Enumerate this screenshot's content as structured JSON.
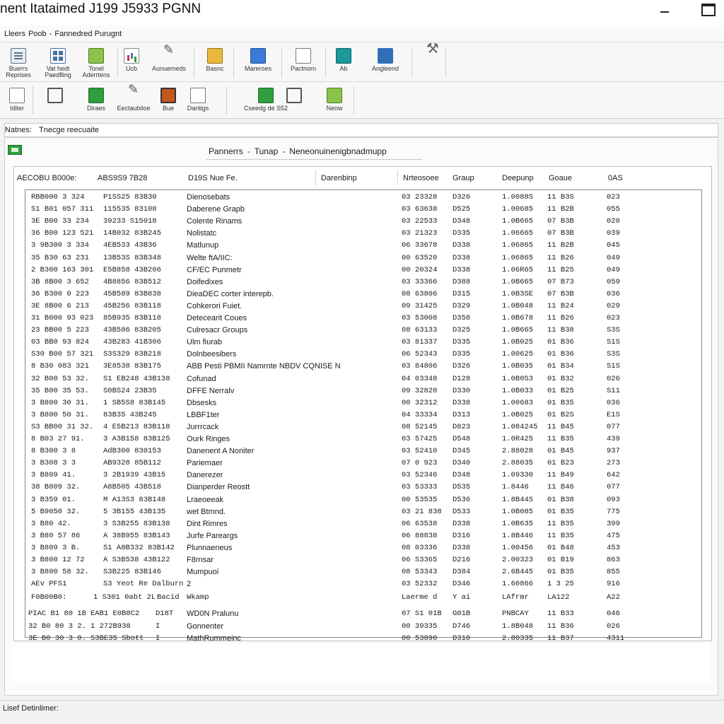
{
  "window": {
    "title": "nent Itataimed J199 J5933 PGNN"
  },
  "menu": {
    "items": [
      "Lleers",
      "Poob",
      "-",
      "Fannedred Purugnt"
    ]
  },
  "ribbon_top": [
    {
      "label1": "Buerrs",
      "label2": "Reprises",
      "icon": "document-icon"
    },
    {
      "label1": "Vat hedt",
      "label2": "Paedfling",
      "icon": "grid-icon"
    },
    {
      "label1": "Tonel",
      "label2": "Aderrtens",
      "icon": "stack-icon"
    },
    {
      "label1": "Ucb",
      "label2": "",
      "icon": "chart-icon"
    },
    {
      "label1": "Aunuemeds",
      "label2": "",
      "icon": "brush-icon"
    },
    {
      "label1": "Basnc",
      "label2": "",
      "icon": "folder-icon"
    },
    {
      "label1": "Mareroes",
      "label2": "",
      "icon": "blue-book-icon"
    },
    {
      "label1": "Pactnorn",
      "label2": "",
      "icon": "page-icon"
    },
    {
      "label1": "Ab",
      "label2": "",
      "icon": "teal-circle-icon"
    },
    {
      "label1": "Angleend",
      "label2": "",
      "icon": "house-icon"
    },
    {
      "label1": "",
      "label2": "",
      "icon": "tools-icon"
    }
  ],
  "ribbon_bottom": [
    {
      "label": "Iditer",
      "icon": "page-icon"
    },
    {
      "label": "",
      "icon": "gear-icon"
    },
    {
      "label": "Diraes",
      "icon": "green-icon"
    },
    {
      "label": "Eectaubiloe",
      "icon": "brush-icon"
    },
    {
      "label": "Bue",
      "icon": "orange-icon"
    },
    {
      "label": "Dantigs",
      "icon": "page-icon"
    },
    {
      "label": "Cseedg de S52",
      "icon": "green-icon"
    },
    {
      "label": "",
      "icon": "gear-icon"
    },
    {
      "label": "Neow",
      "icon": "green-icon"
    }
  ],
  "filter": {
    "label": "Natnes:",
    "value": "Tnecge reecuaite"
  },
  "breadcrumb": {
    "parts": [
      "Pannerrs",
      "Tunap",
      "Neneonuinenigbnadmupp"
    ],
    "sep": "-"
  },
  "columns": [
    "AECOBU B000e:",
    "ABS9S9 7B28",
    "D19S Nue Fe.",
    "Darenbinp",
    "Nrteosoee",
    "Graup",
    "Deepunp",
    "Goaue",
    "0AS"
  ],
  "rows": [
    [
      "RBB000 3 324",
      "P1SS25 83B30",
      "Dienosebats",
      "03 23328",
      "D326",
      "1.0088S",
      "11 B3S",
      "023"
    ],
    [
      "S1 B01 057 311",
      "115535 83108",
      "Daberene Grapb",
      "03 63638",
      "D525",
      "1.00685",
      "11 B2B",
      "055"
    ],
    [
      "3E B00 33 234",
      "39233 S15018",
      "Colente Rinams",
      "03 22533",
      "D348",
      "1.0B665",
      "07 B3B",
      "020"
    ],
    [
      "36 B00 123 521",
      "14B032 83B245",
      "Nolistatc",
      "03 21323",
      "D335",
      "1.06665",
      "07 B3B",
      "039"
    ],
    [
      "3 9B300 3 334",
      "4EB533 43B36",
      "Matlunup",
      "06 33678",
      "D338",
      "1.06865",
      "11 B2B",
      "045"
    ],
    [
      "35 B30 63 231",
      "13B53S 83B348",
      "Welte ftA/IIC:",
      "00 63520",
      "D338",
      "1.06865",
      "11 B26",
      "049"
    ],
    [
      "2 B300 163 301",
      "E5B858 43B206",
      "CF/EC Punmetr",
      "00 20324",
      "D338",
      "1.06R65",
      "11 B25",
      "049"
    ],
    [
      "3B 8B00 3 652",
      "4B8856 83B512",
      "Doifedixes",
      "03 33366",
      "D388",
      "1.0B665",
      "07 B73",
      "059"
    ],
    [
      "36 B300 0 223",
      "45B589 83B838",
      "DieaDEC corter interepb.",
      "08 63806",
      "D315",
      "1.0B3SE",
      "07 B3B",
      "036"
    ],
    [
      "3E 8B00 6 213",
      "45B256 83B118",
      "Cohkerori Fuiet.",
      "09 31425",
      "D329",
      "1.0B048",
      "11 B24",
      "029"
    ],
    [
      "31 B000 93 023",
      "85B935 83B118",
      "Detecearit Coues",
      "03 53008",
      "D358",
      "1.0B678",
      "11 B26",
      "023"
    ],
    [
      "23 BB00 5 223",
      "43B586 83B205",
      "Culresacr Groups",
      "08 63133",
      "D325",
      "1.0B665",
      "11 B38",
      "S3S"
    ],
    [
      "03 BB0 93 824",
      "43B283 41B306",
      "Ulm fiurab",
      "03 81337",
      "D335",
      "1.0B025",
      "01 B36",
      "S1S"
    ],
    [
      "S30 B00 57 321",
      "S3S329 83B218",
      "Dolnbeesibers",
      "06 52343",
      "D335",
      "1.00625",
      "01 B36",
      "S3S"
    ],
    [
      "8 B30 083 321",
      "3E8538 83B175",
      "ABB Pesti PBMII Namrnte NBDV CQNISE N",
      "03 84806",
      "D326",
      "1.0B035",
      "01 B34",
      "S1S"
    ],
    [
      "32 B00 53 32.",
      "S1 EB248 43B138",
      "Cofunad",
      "04 03348",
      "D128",
      "1.0B0S3",
      "01 B32",
      "026"
    ],
    [
      "35 B00 35 53.",
      "S0BS24 23B35",
      "DFFE Nerralv",
      "09 32820",
      "D330",
      "1.0B033",
      "01 B25",
      "S11"
    ],
    [
      "3 B800 30 31.",
      "1 SB5S8 83B145",
      "Dbsesks",
      "00 32312",
      "D338",
      "1.00683",
      "01 B35",
      "036"
    ],
    [
      "3 B800 50 31.",
      "83B35 43B245",
      "LBBF1ter",
      "04 33334",
      "D313",
      "1.0B025",
      "01 B2S",
      "E1S"
    ],
    [
      "S3 BB00 31 32.",
      "4 E5B213 83B118",
      "Jurrrcack",
      "08 52145",
      "D823",
      "1.084245",
      "11 B45",
      "077"
    ],
    [
      "8 B03 27 91.",
      "3 A3B158 83B125",
      "Ourk Ringes",
      "03 57425",
      "D548",
      "1.0R425",
      "11 B35",
      "439"
    ],
    [
      "8 B300 3 8",
      "AdB300 830153",
      "Danenent A Noniter",
      "03 52410",
      "D345",
      "2.88028",
      "01 B45",
      "937"
    ],
    [
      "3 B308 3 3",
      "AB9328 85B112",
      "Pariemaer",
      "07 0 923",
      "D340",
      "2.88035",
      "01 B23",
      "273"
    ],
    [
      "3 B809 41.",
      "3 2B1939 43B15",
      "Danerezer",
      "03 52346",
      "D348",
      "1.09330",
      "11 B49",
      "642"
    ],
    [
      "38 B809 32.",
      "A8B505 43B518",
      "Dianperder Reostt",
      "03 53333",
      "D535",
      "1.8446",
      "11 B46",
      "077"
    ],
    [
      "3 B359 01.",
      "M A13S3 83B148",
      "Lraeoeeak",
      "00 53535",
      "D536",
      "1.8B44S",
      "01 B38",
      "093"
    ],
    [
      "5 B9050 32.",
      "5 3B155 43B135",
      "wet Btmnd.",
      "03 21 838",
      "D533",
      "1.0B085",
      "01 B35",
      "775"
    ],
    [
      "3 B80 42.",
      "3 S3B255 83B138",
      "Dint Rimres",
      "06 63538",
      "D338",
      "1.0B635",
      "11 B35",
      "399"
    ],
    [
      "3 B80 57 86",
      "A 38B955 83B143",
      "Jurfe Pareargs",
      "06 88838",
      "D316",
      "1.8B446",
      "11 B35",
      "475"
    ],
    [
      "3 B809 3 B.",
      "S1 A8B332 83B142",
      "Plunnaeneus",
      "08 03336",
      "D338",
      "1.00456",
      "01 B48",
      "453"
    ],
    [
      "3 B800 12 72",
      "A S3B538 43B122",
      "F8rnsar",
      "06 S3365",
      "D216",
      "2.00323",
      "01 B19",
      "863"
    ],
    [
      "3 B800 58 32.",
      "S3B225 83B146",
      "Mumpuoi",
      "08 53343",
      "D384",
      "2.6B445",
      "01 B35",
      "855"
    ]
  ],
  "summary_row": [
    "AEv PFS1",
    "S3  Yeot Re Dalburn",
    "2",
    "03 52332",
    "D346",
    "1.60866",
    "1 3 25",
    "916"
  ],
  "subhead_row": [
    "F0B00B0:",
    "1 S301 0abt 2L",
    "Bacid",
    "Wkamp",
    "Laerme d",
    "Y ai",
    "LAfrmr",
    "LA122",
    "A22"
  ],
  "tail_rows": [
    [
      "PIAC B1 80 1B",
      "EAB1 E0B8C2",
      "D18T",
      "WD0N Pralunu",
      "07 S1 01B",
      "G01B",
      "PNBCAY",
      "11 B33",
      "046"
    ],
    [
      "32 B0 80 3 2.",
      "1 272B938",
      "I",
      "Gonnenter",
      "00 39335",
      "D746",
      "1.8B048",
      "11 B36",
      "026"
    ],
    [
      "3E B0 30 3 0.",
      "S3BE35 Sbott",
      "I",
      "MathRummeinc",
      "00 53890",
      "D310",
      "2.80335",
      "11 B37",
      "4311"
    ]
  ],
  "status": {
    "text": "Lisef Detinlimer:"
  }
}
